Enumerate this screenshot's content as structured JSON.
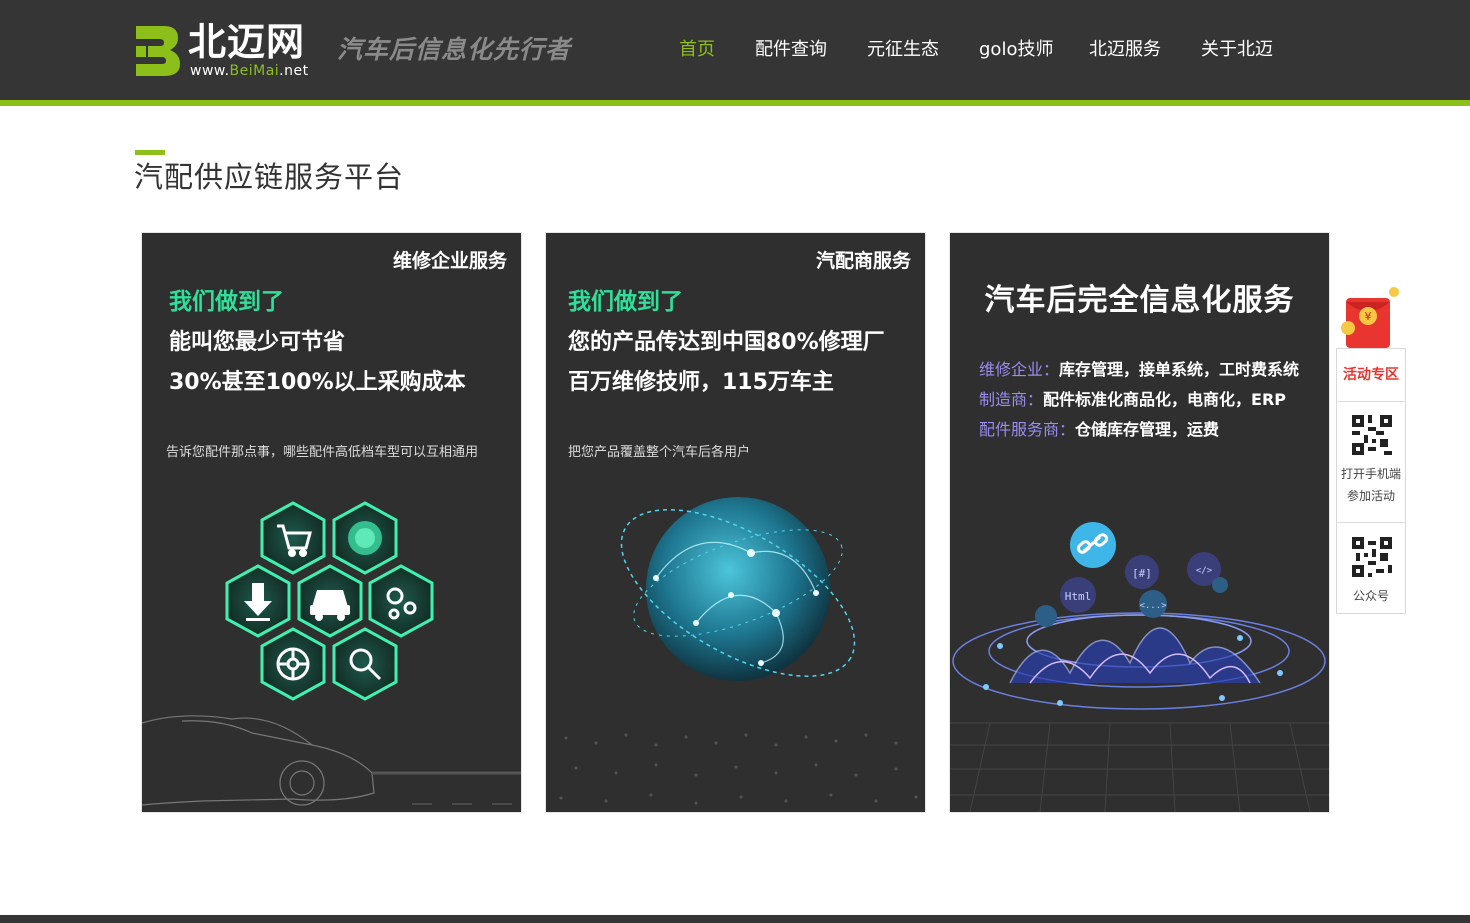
{
  "header": {
    "logo": {
      "name": "北迈网",
      "url_prefix": "www.",
      "url_brand": "BeiMai",
      "url_suffix": ".net",
      "mark_letter": "B"
    },
    "slogan": "汽车后信息化先行者",
    "nav": [
      {
        "label": "首页",
        "active": true
      },
      {
        "label": "配件查询",
        "active": false
      },
      {
        "label": "元征生态",
        "active": false
      },
      {
        "label": "golo技师",
        "active": false
      },
      {
        "label": "北迈服务",
        "active": false
      },
      {
        "label": "关于北迈",
        "active": false
      }
    ]
  },
  "section": {
    "title": "汽配供应链服务平台"
  },
  "cards": [
    {
      "tag": "维修企业服务",
      "headline": "我们做到了",
      "lines": [
        "能叫您最少可节省",
        "30%甚至100%以上采购成本"
      ],
      "description": "告诉您配件那点事，哪些配件高低档车型可以互相通用",
      "icons": [
        "cart-icon",
        "globe-icon",
        "download-icon",
        "car-icon",
        "gears-icon",
        "wheel-icon",
        "magnifier-icon"
      ]
    },
    {
      "tag": "汽配商服务",
      "headline": "我们做到了",
      "lines": [
        "您的产品传达到中国80%修理厂",
        "百万维修技师，115万车主"
      ],
      "description": "把您产品覆盖整个汽车后各用户"
    },
    {
      "title": "汽车后完全信息化服务",
      "services": [
        {
          "key": "维修企业：",
          "value": "库存管理，接单系统，工时费系统"
        },
        {
          "key": "制造商：",
          "value": "配件标准化商品化，电商化，ERP"
        },
        {
          "key": "配件服务商：",
          "value": "仓储库存管理，运费"
        }
      ],
      "illustration_labels": [
        "Html",
        "[#]",
        "<...>",
        "</>"
      ]
    }
  ],
  "side": {
    "promo": "活动专区",
    "qr1_caption": [
      "打开手机端",
      "参加活动"
    ],
    "qr2_caption": "公众号",
    "redpacket_symbol": "¥"
  },
  "colors": {
    "header_bg": "#353535",
    "accent_green": "#8cbf1a",
    "card_bg": "#2f2f2f",
    "headline_green": "#2fdf9a",
    "service_purple": "#9a8cf0",
    "promo_red": "#e8352f"
  }
}
